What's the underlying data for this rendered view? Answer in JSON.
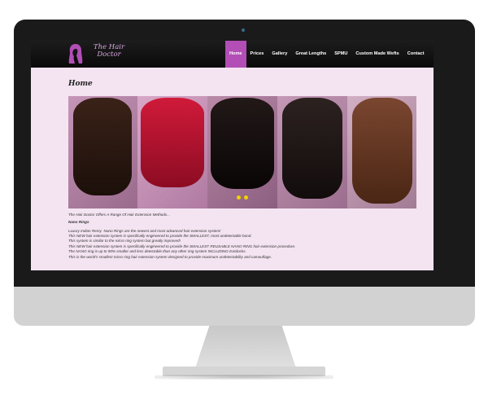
{
  "site": {
    "logo_text_line1": "The Hair",
    "logo_text_line2": "Doctor"
  },
  "nav": {
    "items": [
      {
        "label": "Home",
        "active": true
      },
      {
        "label": "Prices",
        "active": false
      },
      {
        "label": "Gallery",
        "active": false
      },
      {
        "label": "Great Lengths",
        "active": false
      },
      {
        "label": "SPMU",
        "active": false
      },
      {
        "label": "Custom Made Wefts",
        "active": false
      },
      {
        "label": "Contact",
        "active": false
      }
    ]
  },
  "main": {
    "page_title": "Home",
    "banner": {
      "slides": [
        {
          "hair_color": "#2a1812"
        },
        {
          "hair_color": "#b0142e"
        },
        {
          "hair_color": "#141010"
        },
        {
          "hair_color": "#1d1716"
        },
        {
          "hair_color": "#6a3c26"
        }
      ],
      "dot_count": 2
    },
    "intro": "The Hair Doctor Offers A Range Of Hair Extension Methods...",
    "section_heading": "Nano Rings",
    "paragraphs": [
      "Luxury Indian Remy -Nano Rings are the newest and most advanced hair extension system!",
      "This NEW hair extension system is specifically engineered to provide the SMALLEST, most undetectable bond.",
      "This system is similar to the micro ring system but greatly improved!",
      "This NEW hair extension system is specifically engineered to provide the SMALLEST REUSABLE NANO RING hair extension procedure.",
      "The NANO ring is up to 90% smaller and less detectable than any other ring system INCLUDING Easilocks.",
      "This is the world's smallest micro ring hair extension system designed to provide maximum undetectability and camouflage."
    ]
  },
  "colors": {
    "accent": "#b24eb6",
    "page_bg": "#f4e4f2",
    "nav_bg": "#111111",
    "logo": "#d7a6e0"
  },
  "icons": {
    "logo_mark": "woman-silhouette-icon"
  }
}
